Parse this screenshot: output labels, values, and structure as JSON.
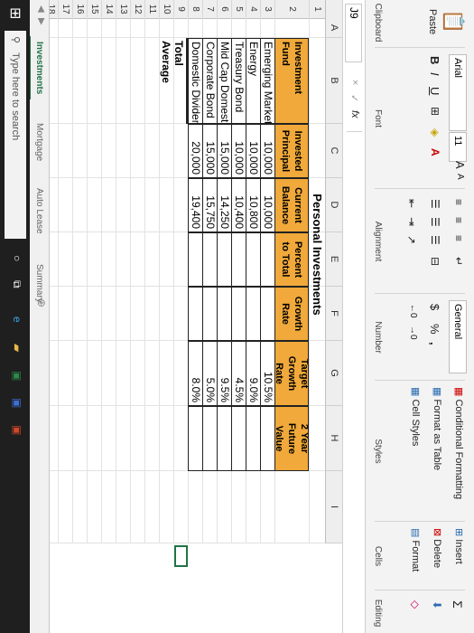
{
  "ribbon": {
    "clipboard": {
      "paste": "Paste",
      "label": "Clipboard"
    },
    "font": {
      "name": "Arial",
      "size": "11",
      "bold": "B",
      "italic": "I",
      "underline": "U",
      "grow": "A",
      "shrink": "A",
      "label": "Font"
    },
    "alignment": {
      "label": "Alignment"
    },
    "number": {
      "format": "General",
      "currency": "$",
      "percent": "%",
      "comma": ",",
      "label": "Number"
    },
    "styles": {
      "conditional": "Conditional Formatting",
      "format_table": "Format as Table",
      "cell_styles": "Cell Styles",
      "label": "Styles"
    },
    "cells": {
      "insert": "Insert",
      "delete": "Delete",
      "format": "Format",
      "label": "Cells"
    },
    "editing": {
      "label": "Editing"
    }
  },
  "formula_bar": {
    "name_box": "J9",
    "fx": "fx",
    "cancel": "×",
    "enter": "✓"
  },
  "columns": [
    "A",
    "B",
    "C",
    "D",
    "E",
    "F",
    "G",
    "H",
    "I"
  ],
  "rows": [
    "1",
    "2",
    "3",
    "4",
    "5",
    "6",
    "7",
    "8",
    "9",
    "10",
    "11",
    "12",
    "13",
    "14",
    "15",
    "16",
    "17",
    "18"
  ],
  "sheet": {
    "title": "Personal Investments",
    "headers": [
      "Investment Fund",
      "Invested Principal",
      "Current Balance",
      "Percent to Total",
      "Growth Rate",
      "Target Growth Rate",
      "2 Year Future Value"
    ],
    "data": [
      {
        "fund": "Emerging Markets",
        "principal": "10,000",
        "balance": "10,000",
        "target": "10.5%"
      },
      {
        "fund": "Energy",
        "principal": "10,000",
        "balance": "10,800",
        "target": "9.0%"
      },
      {
        "fund": "Treasury Bond",
        "principal": "10,000",
        "balance": "10,400",
        "target": "4.5%"
      },
      {
        "fund": "Mid Cap Domestic",
        "principal": "15,000",
        "balance": "14,250",
        "target": "9.5%"
      },
      {
        "fund": "Corporate Bond",
        "principal": "15,000",
        "balance": "15,750",
        "target": "5.0%"
      },
      {
        "fund": "Domestic Dividend",
        "principal": "20,000",
        "balance": "19,400",
        "target": "8.0%"
      }
    ],
    "total_label": "Total",
    "average_label": "Average"
  },
  "tabs": [
    "Investments",
    "Mortgage",
    "Auto Lease",
    "Summary"
  ],
  "active_tab": 0,
  "taskbar": {
    "search_placeholder": "Type here to search"
  }
}
